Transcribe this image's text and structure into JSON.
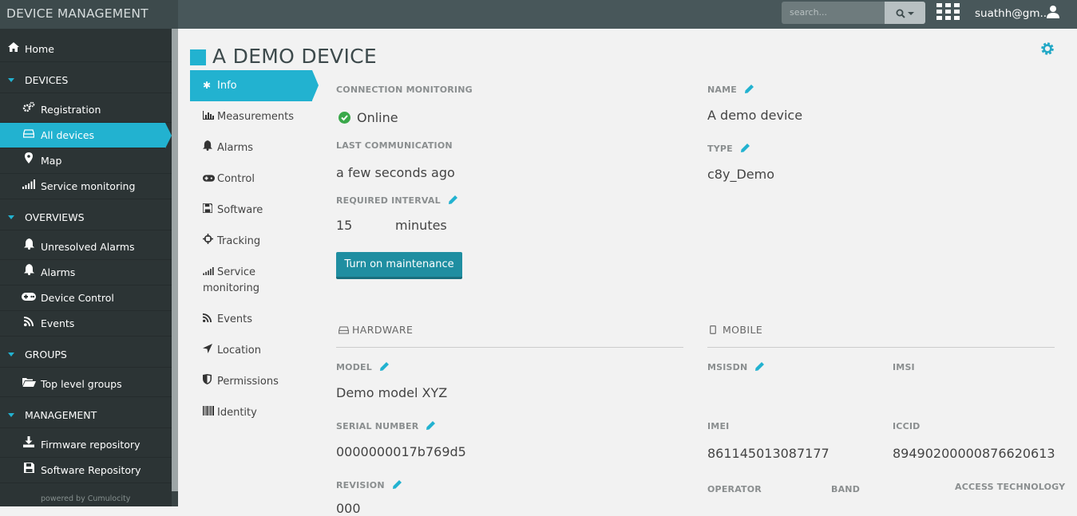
{
  "app": {
    "title": "DEVICE MANAGEMENT"
  },
  "topbar": {
    "search_placeholder": "search...",
    "user": "suathh@gm..."
  },
  "sidebar": {
    "home": "Home",
    "sections": [
      {
        "label": "DEVICES",
        "items": [
          "Registration",
          "All devices",
          "Map",
          "Service monitoring"
        ]
      },
      {
        "label": "OVERVIEWS",
        "items": [
          "Unresolved Alarms",
          "Alarms",
          "Device Control",
          "Events"
        ]
      },
      {
        "label": "GROUPS",
        "items": [
          "Top level groups"
        ]
      },
      {
        "label": "MANAGEMENT",
        "items": [
          "Firmware repository",
          "Software Repository"
        ]
      }
    ],
    "active_item": "All devices",
    "footer": "powered by Cumulocity"
  },
  "page": {
    "title": "A DEMO DEVICE"
  },
  "tabs": [
    "Info",
    "Measurements",
    "Alarms",
    "Control",
    "Software",
    "Tracking",
    "Service monitoring",
    "Events",
    "Location",
    "Permissions",
    "Identity"
  ],
  "active_tab": "Info",
  "connection": {
    "title": "CONNECTION MONITORING",
    "status": "Online",
    "last_comm_label": "LAST COMMUNICATION",
    "last_comm_value": "a few seconds ago",
    "interval_label": "REQUIRED INTERVAL",
    "interval_value": "15",
    "interval_unit": "minutes",
    "maintenance_button": "Turn on maintenance"
  },
  "device": {
    "name_label": "NAME",
    "name_value": "A demo device",
    "type_label": "TYPE",
    "type_value": "c8y_Demo"
  },
  "hardware": {
    "title": "HARDWARE",
    "model_label": "MODEL",
    "model_value": "Demo model XYZ",
    "serial_label": "SERIAL NUMBER",
    "serial_value": "0000000017b769d5",
    "revision_label": "REVISION",
    "revision_value": "000"
  },
  "mobile": {
    "title": "MOBILE",
    "msisdn_label": "MSISDN",
    "imsi_label": "IMSI",
    "imei_label": "IMEI",
    "imei_value": "861145013087177",
    "iccid_label": "ICCID",
    "iccid_value": "89490200000876620613",
    "operator_label": "OPERATOR",
    "band_label": "BAND",
    "access_label": "ACCESS TECHNOLOGY"
  },
  "colors": {
    "accent": "#22b2d0",
    "topbar": "#48575a",
    "sidebar": "#2c3435",
    "button": "#1f8ea1",
    "online": "#3aa84a"
  }
}
